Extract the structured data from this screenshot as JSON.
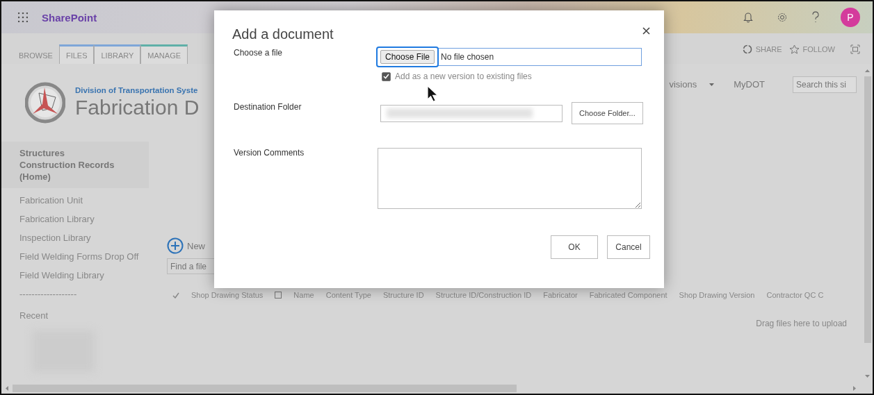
{
  "suite_bar": {
    "app_name": "SharePoint",
    "avatar_initial": "P"
  },
  "ribbon": {
    "tabs": [
      {
        "label": "BROWSE"
      },
      {
        "label": "FILES",
        "color": "#7ea6d8"
      },
      {
        "label": "LIBRARY",
        "color": "#7ea6d8"
      },
      {
        "label": "MANAGE",
        "color": "#5fb0a8"
      }
    ],
    "actions": [
      "SHARE",
      "FOLLOW"
    ]
  },
  "site_header": {
    "subtitle": "Division of Transportation Syste",
    "title": "Fabrication D",
    "nav": [
      {
        "label": "visions",
        "dropdown": true
      },
      {
        "label": "MyDOT",
        "dropdown": false
      }
    ],
    "search_placeholder": "Search this si"
  },
  "left_nav": {
    "items": [
      {
        "label": "Structures Construction Records (Home)",
        "selected": true
      },
      {
        "label": "Fabrication Unit",
        "selected": false
      },
      {
        "label": "Fabrication Library",
        "selected": false
      },
      {
        "label": "Inspection Library",
        "selected": false
      },
      {
        "label": "Field Welding Forms Drop Off",
        "selected": false
      },
      {
        "label": "Field Welding Library",
        "selected": false
      },
      {
        "label": "-------------------",
        "selected": false
      }
    ],
    "recent_heading": "Recent"
  },
  "library": {
    "new_button": "New",
    "search_placeholder": "Find a file",
    "columns": [
      "Shop Drawing Status",
      "Name",
      "Content Type",
      "Structure ID",
      "Structure ID/Construction ID",
      "Fabricator",
      "Fabricated Component",
      "Shop Drawing Version",
      "Contractor QC C"
    ],
    "drop_hint": "Drag files here to upload"
  },
  "dialog": {
    "title": "Add a document",
    "choose_file_label": "Choose a file",
    "file_button": "Choose File",
    "file_status": "No file chosen",
    "version_checkbox": {
      "label": "Add as a new version to existing files",
      "checked": true
    },
    "destination_label": "Destination Folder",
    "choose_folder_button": "Choose Folder...",
    "comments_label": "Version Comments",
    "buttons": [
      "OK",
      "Cancel"
    ]
  }
}
